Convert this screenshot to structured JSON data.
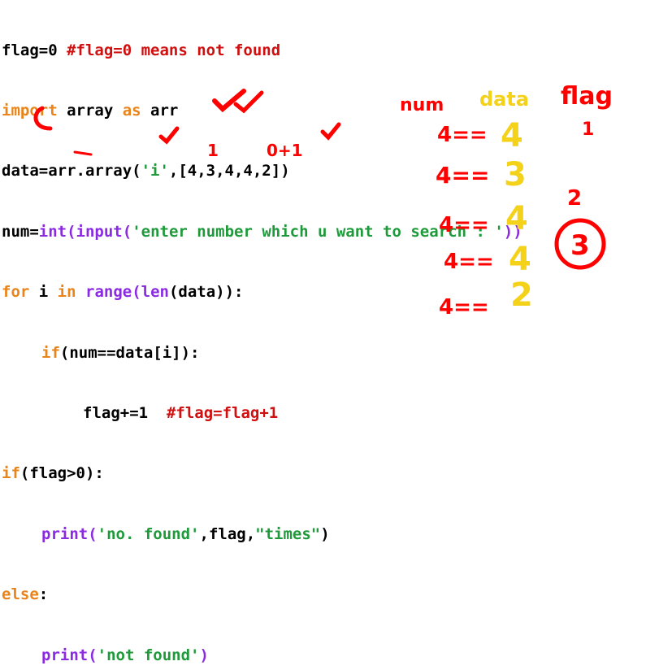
{
  "code": {
    "l1_code": "flag=0 ",
    "l1_comment": "#flag=0 means not found",
    "l2_import": "import",
    "l2_mid": " array ",
    "l2_as": "as",
    "l2_end": " arr",
    "l3_a": "data=arr.array(",
    "l3_str": "'i'",
    "l3_b": ",[4,3,4,4,2])",
    "l4_a": "num=",
    "l4_int": "int",
    "l4_p1": "(",
    "l4_input": "input",
    "l4_p2": "(",
    "l4_str": "'enter number which u want to search : '",
    "l4_p3": "))",
    "l5_for": "for",
    "l5_i": " i ",
    "l5_in": "in",
    "l5_sp": " ",
    "l5_range": "range",
    "l5_p": "(",
    "l5_len": "len",
    "l5_end": "(data)):",
    "l6_if": "if",
    "l6_end": "(num==data[i]):",
    "l7_code": "flag+=1  ",
    "l7_comment": "#flag=flag+1",
    "l8_if": "if",
    "l8_end": "(flag>0):",
    "l9_print": "print",
    "l9_p": "(",
    "l9_s1": "'no. found'",
    "l9_mid": ",flag,",
    "l9_s2": "\"times\"",
    "l9_end": ")",
    "l10_else": "else",
    "l10_end": ":",
    "l11_print": "print",
    "l11_p": "(",
    "l11_s": "'not found'",
    "l11_end": ")"
  },
  "annotations": {
    "num_label": "num",
    "data_label": "data",
    "flag_label": "flag",
    "flag_init": "1",
    "rows": [
      {
        "num": "4==",
        "data": "4"
      },
      {
        "num": "4==",
        "data": "3"
      },
      {
        "num": "4==",
        "data": "4"
      },
      {
        "num": "4==",
        "data": "4"
      },
      {
        "num": "4==",
        "data": "2"
      }
    ],
    "count_two": "2",
    "count_three": "3",
    "below_flag": "1",
    "below_comment": "0+1"
  }
}
